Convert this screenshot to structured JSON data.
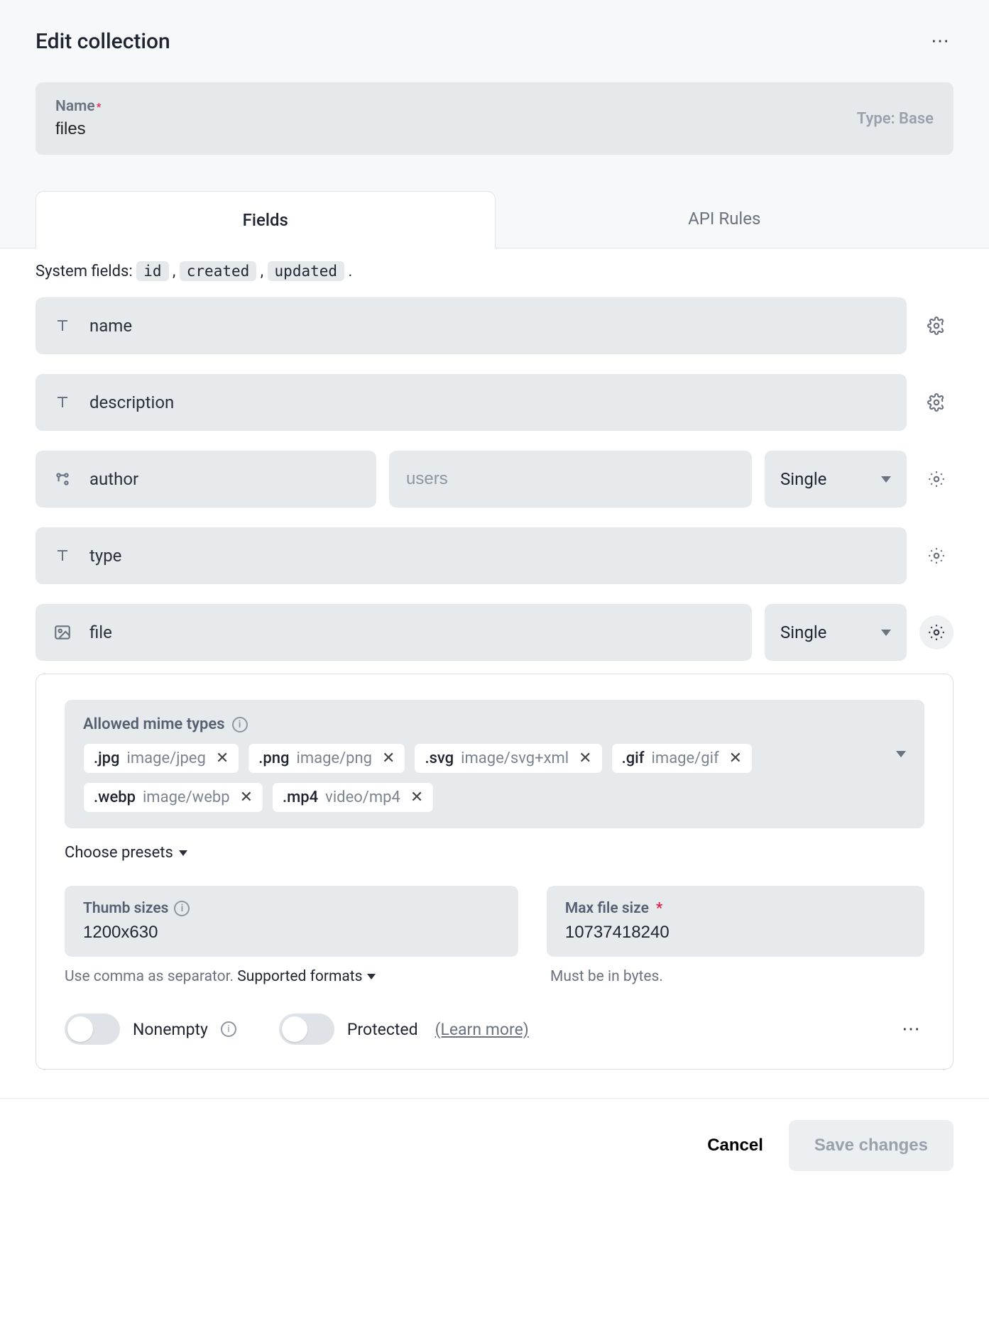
{
  "header": {
    "title": "Edit collection",
    "name_label": "Name",
    "name_value": "files",
    "type_label": "Type: Base"
  },
  "tabs": {
    "fields": "Fields",
    "api_rules": "API Rules"
  },
  "system_fields": {
    "prefix": "System fields:",
    "items": [
      "id",
      "created",
      "updated"
    ]
  },
  "fields": [
    {
      "key": "name",
      "name": "name",
      "type": "text"
    },
    {
      "key": "description",
      "name": "description",
      "type": "text"
    },
    {
      "key": "author",
      "name": "author",
      "type": "relation",
      "relation_collection_placeholder": "users",
      "rel_mode": "Single"
    },
    {
      "key": "type",
      "name": "type",
      "type": "text"
    },
    {
      "key": "file",
      "name": "file",
      "type": "file",
      "rel_mode": "Single"
    }
  ],
  "file_options": {
    "mime_label": "Allowed mime types",
    "mime_types": [
      {
        "ext": ".jpg",
        "mime": "image/jpeg"
      },
      {
        "ext": ".png",
        "mime": "image/png"
      },
      {
        "ext": ".svg",
        "mime": "image/svg+xml"
      },
      {
        "ext": ".gif",
        "mime": "image/gif"
      },
      {
        "ext": ".webp",
        "mime": "image/webp"
      },
      {
        "ext": ".mp4",
        "mime": "video/mp4"
      }
    ],
    "choose_presets": "Choose presets",
    "thumb_label": "Thumb sizes",
    "thumb_value": "1200x630",
    "thumb_help": "Use comma as separator.",
    "supported_formats": "Supported formats",
    "maxsize_label": "Max file size",
    "maxsize_value": "10737418240",
    "maxsize_help": "Must be in bytes.",
    "nonempty_label": "Nonempty",
    "protected_label": "Protected",
    "learn_more": "(Learn more)"
  },
  "footer": {
    "cancel": "Cancel",
    "save": "Save changes"
  }
}
